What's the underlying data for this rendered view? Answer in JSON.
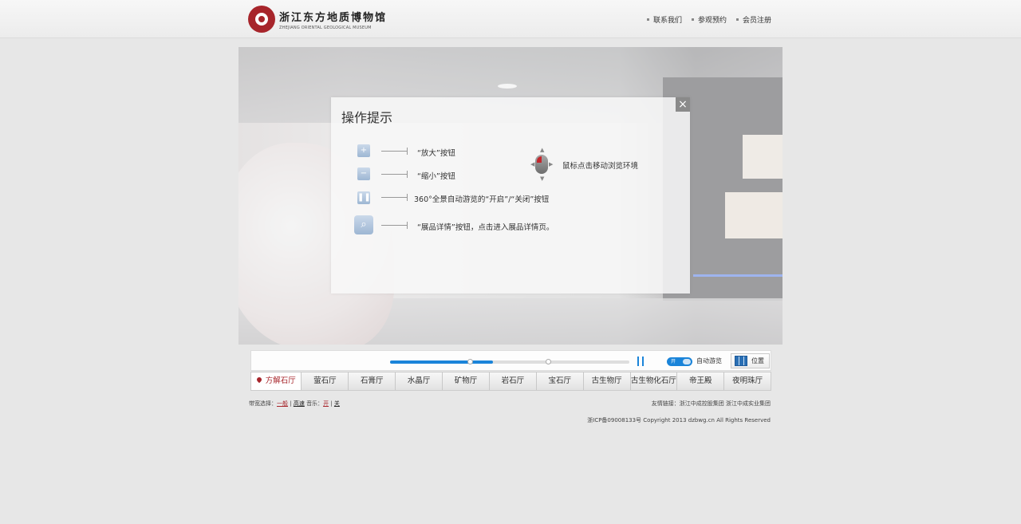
{
  "header": {
    "logo_cn": "浙江东方地质博物馆",
    "logo_en": "ZHEJIANG ORIENTAL GEOLOGICAL MUSEUM",
    "nav": [
      "联系我们",
      "参观预约",
      "会员注册"
    ]
  },
  "tip": {
    "title": "操作提示",
    "close": "×",
    "zoom_in": "“放大”按钮",
    "zoom_out": "“缩小”按钮",
    "autotour": "360°全景自动游览的“开启”/“关闭”按钮",
    "detail": "“展品详情”按钮，点击进入展品详情页。",
    "mouse": "鼠标点击移动浏览环境"
  },
  "controls": {
    "progress": 0.43,
    "toggle_text": "开",
    "auto_label": "自动游览",
    "position_label": "位置"
  },
  "halls": [
    "方解石厅",
    "萤石厅",
    "石膏厅",
    "水晶厅",
    "矿物厅",
    "岩石厅",
    "宝石厅",
    "古生物厅",
    "古生物化石厅",
    "帝王殿",
    "夜明珠厅"
  ],
  "active_hall": 0,
  "footer": {
    "bandwidth_label": "带宽选择：",
    "bw_normal": "一般",
    "bw_fast": "高速",
    "music_label": "音乐：",
    "music_on": "开",
    "music_off": "关",
    "sep": "|",
    "friend_links": "友情链接：浙江中成控股集团 浙江中成实业集团",
    "copyright": "浙ICP备09008133号 Copyright 2013 dzbwg.cn All Rights Reserved"
  },
  "colors": {
    "brand": "#a7252b",
    "accent": "#1a84d9"
  }
}
